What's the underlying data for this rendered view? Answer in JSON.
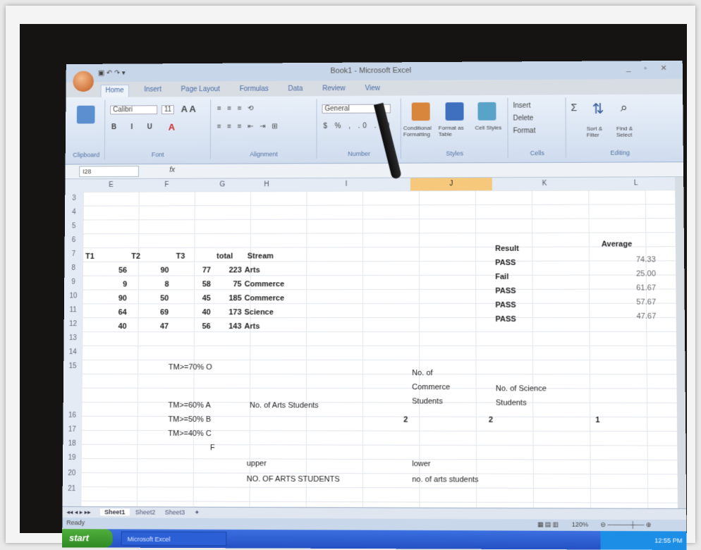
{
  "app": {
    "title": "Book1 - Microsoft Excel",
    "tabs": [
      "Home",
      "Insert",
      "Page Layout",
      "Formulas",
      "Data",
      "Review",
      "View"
    ],
    "ribbon": {
      "font_name": "Calibri",
      "font_size": "11",
      "number_format": "General",
      "groups": [
        "Clipboard",
        "Font",
        "Alignment",
        "Number",
        "Styles",
        "Cells",
        "Editing"
      ],
      "buttons": {
        "conditional": "Conditional Formatting",
        "format_table": "Format as Table",
        "cell_styles": "Cell Styles",
        "insert": "Insert",
        "delete": "Delete",
        "format": "Format",
        "sort": "Sort & Filter",
        "find": "Find & Select"
      }
    },
    "formula_bar": {
      "name_box": "I28",
      "fx": "fx"
    },
    "columns": [
      "E",
      "F",
      "G",
      "H",
      "I",
      "J",
      "K",
      "L"
    ],
    "rows": [
      "3",
      "4",
      "5",
      "6",
      "7",
      "8",
      "9",
      "10",
      "11",
      "12",
      "13",
      "14",
      "15",
      "16",
      "17",
      "18",
      "19",
      "20",
      "21"
    ]
  },
  "cells": {
    "t1": "T1",
    "t2": "T2",
    "t3": "T3",
    "total": "total",
    "stream": "Stream",
    "result": "Result",
    "average": "Average",
    "data_rows": [
      {
        "t1": "56",
        "t2": "90",
        "t3": "77",
        "total": "223",
        "stream": "Arts",
        "result": "PASS",
        "avg": "74.33"
      },
      {
        "t1": "9",
        "t2": "8",
        "t3": "58",
        "total": "75",
        "stream": "Commerce",
        "result": "Fail",
        "avg": "25.00"
      },
      {
        "t1": "90",
        "t2": "50",
        "t3": "45",
        "total": "185",
        "stream": "Commerce",
        "result": "PASS",
        "avg": "61.67"
      },
      {
        "t1": "64",
        "t2": "69",
        "t3": "40",
        "total": "173",
        "stream": "Science",
        "result": "PASS",
        "avg": "57.67"
      },
      {
        "t1": "40",
        "t2": "47",
        "t3": "56",
        "total": "143",
        "stream": "Arts",
        "result": "PASS",
        "avg": "47.67"
      }
    ],
    "grade_o": "TM>=70% O",
    "grade_a": "TM>=60% A",
    "grade_b": "TM>=50% B",
    "grade_c": "TM>=40% C",
    "grade_f": "F",
    "arts_students": "No. of Arts Students",
    "commerce_students_1": "No. of",
    "commerce_students_2": "Commerce",
    "commerce_students_3": "Students",
    "science_students_1": "No. of Science",
    "science_students_2": "Students",
    "count_arts": "2",
    "count_commerce": "2",
    "count_science": "1",
    "upper": "upper",
    "lower": "lower",
    "upper_label": "NO. OF ARTS STUDENTS",
    "lower_label": "no. of arts students"
  },
  "sheets": [
    "Sheet1",
    "Sheet2",
    "Sheet3"
  ],
  "status": {
    "ready": "Ready",
    "zoom": "120%"
  },
  "taskbar": {
    "start": "start",
    "item": "Microsoft Excel",
    "clock": "12:55 PM"
  }
}
